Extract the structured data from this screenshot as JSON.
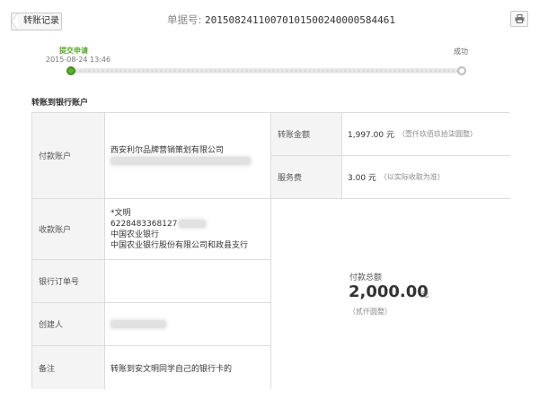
{
  "header": {
    "back_label": "转账记录",
    "receipt_label": "单据号:",
    "receipt_number": "20150824110070101500240000584461",
    "print_icon": "printer-icon"
  },
  "progress": {
    "step1_label": "提交申请",
    "step1_time": "2015-08-24 13:46",
    "step2_label": "成功",
    "accent_color": "#5fb131"
  },
  "section_title": "转账到银行账户",
  "details": {
    "payer_label": "付款账户",
    "payer_name": "西安利尔品牌营销策划有限公司",
    "payee_label": "收款账户",
    "payee_name": "*文明",
    "payee_card": "6228483368127",
    "payee_bank": "中国农业银行",
    "payee_branch": "中国农业银行股份有限公司和政县支行",
    "order_label": "银行订单号",
    "order_value": "",
    "creator_label": "创建人",
    "remark_label": "备注",
    "remark_value": "转账到安文明同学自己的银行卡的",
    "amount_label": "转账金额",
    "amount_value": "1,997.00 元",
    "amount_words": "（壹仟玖佰玖拾柒圆整）",
    "fee_label": "服务费",
    "fee_value": "3.00 元",
    "fee_note": "（以实际收取为准）",
    "total_label": "付款总额",
    "total_value": "2,000.00",
    "total_unit": "元",
    "total_words": "（贰仟圆整）"
  }
}
